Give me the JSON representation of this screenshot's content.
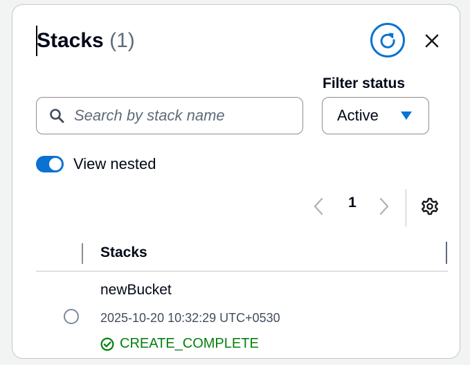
{
  "header": {
    "title": "Stacks",
    "count": "(1)",
    "refresh_icon": "refresh-icon",
    "close_icon": "close-icon"
  },
  "filter": {
    "label": "Filter status",
    "selected": "Active",
    "arrow_icon": "caret-down-icon"
  },
  "search": {
    "placeholder": "Search by stack name",
    "value": "",
    "icon": "search-icon"
  },
  "toggle": {
    "label": "View nested",
    "checked": true
  },
  "pagination": {
    "current_page": "1",
    "prev_icon": "chevron-left-icon",
    "next_icon": "chevron-right-icon",
    "settings_icon": "gear-icon"
  },
  "table": {
    "column_header": "Stacks",
    "rows": [
      {
        "name": "newBucket",
        "timestamp": "2025-10-20 10:32:29 UTC+0530",
        "status": "CREATE_COMPLETE",
        "status_icon": "check-circle-icon"
      }
    ]
  },
  "colors": {
    "accent": "#0972d3",
    "success": "#037f0c",
    "text": "#000716",
    "muted": "#5f6b7a",
    "border": "#8c8c94"
  }
}
